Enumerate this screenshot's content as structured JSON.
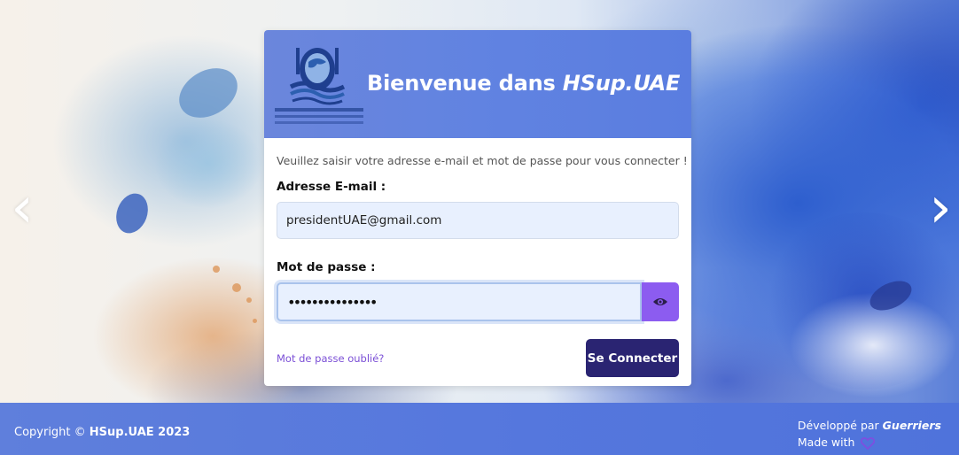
{
  "colors": {
    "header_blue": "#6183e1",
    "primary_button": "#2a2472",
    "eye_button": "#8c5cf0",
    "link": "#7b4fd6",
    "input_bg": "#e8f0fe"
  },
  "carousel": {
    "prev_icon": "chevron-left-icon",
    "next_icon": "chevron-right-icon",
    "prev_glyph": "‹",
    "next_glyph": "›"
  },
  "card": {
    "logo_icon": "university-logo",
    "title_prefix": "Bienvenue dans ",
    "title_brand": "HSup.UAE",
    "intro": "Veuillez saisir votre adresse e-mail et mot de passe pour vous connecter !",
    "email": {
      "label": "Adresse E-mail :",
      "value": "presidentUAE@gmail.com"
    },
    "password": {
      "label": "Mot de passe :",
      "value_masked": "•••••••••••••••",
      "toggle_icon": "eye-icon"
    },
    "forgot_link": "Mot de passe oublié?",
    "submit_label": "Se Connecter"
  },
  "footer": {
    "copyright_prefix": "Copyright © ",
    "copyright_brand": "HSup.UAE 2023",
    "dev_prefix": "Développé par ",
    "dev_author": "Guerriers",
    "made_with": "Made with",
    "heart_icon": "heart-icon"
  }
}
